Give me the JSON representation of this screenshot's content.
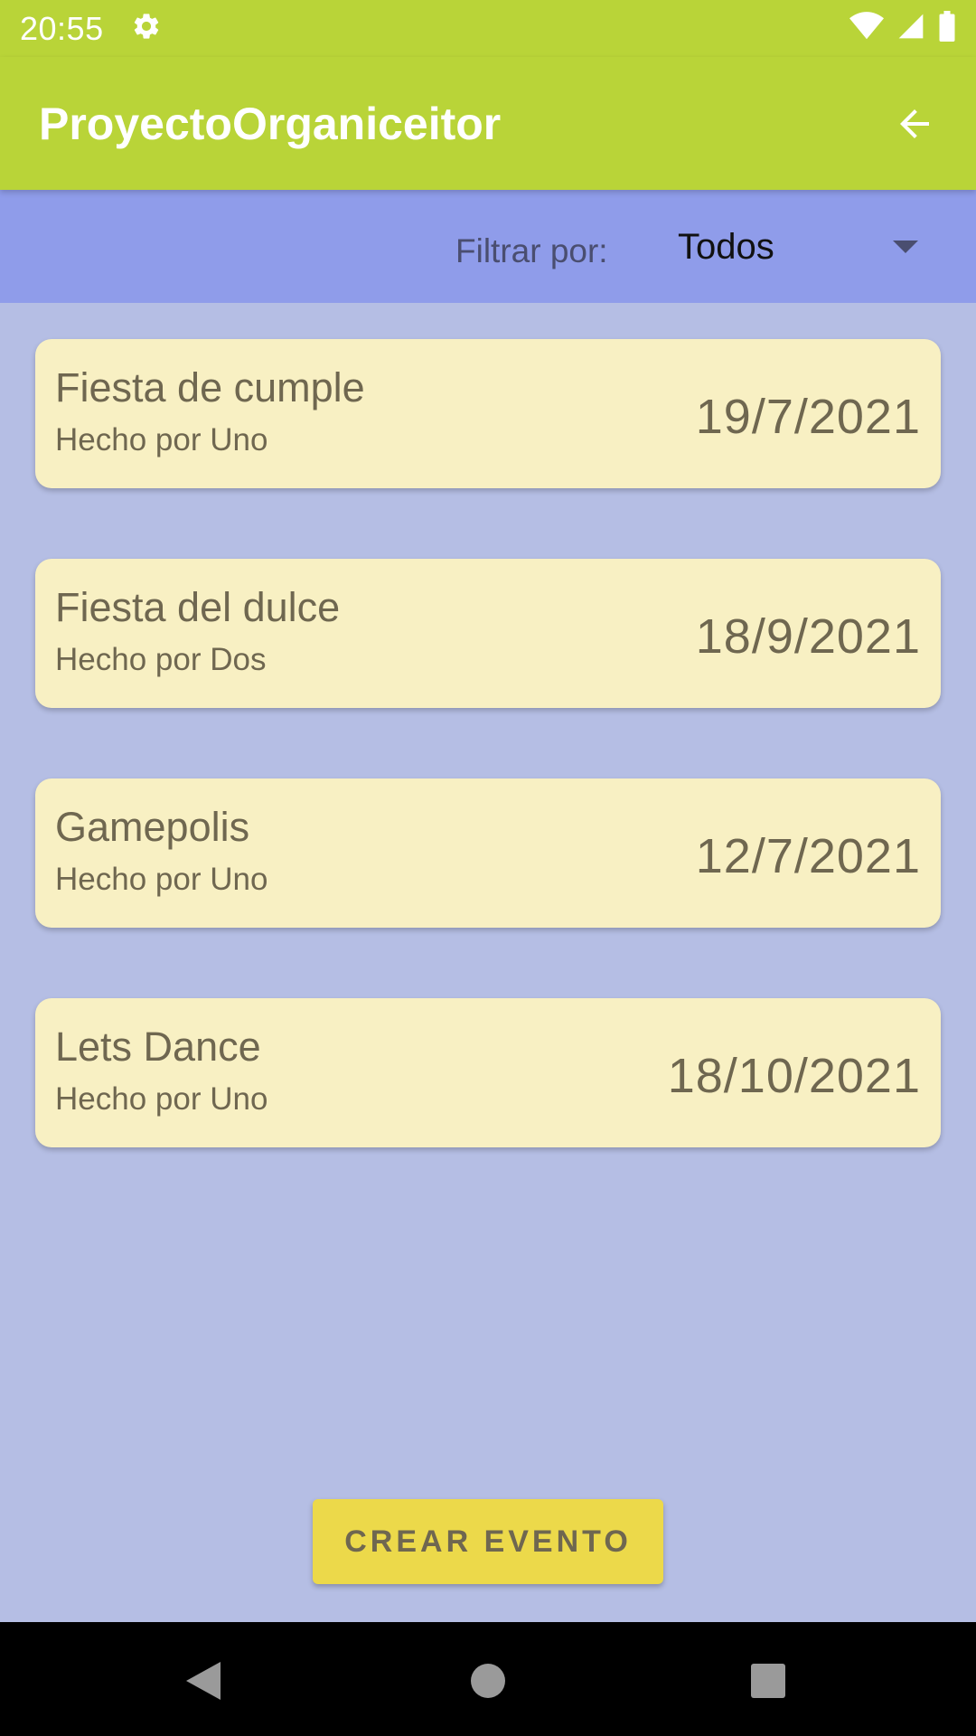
{
  "status_bar": {
    "time": "20:55",
    "icons": [
      "settings-icon",
      "wifi-icon",
      "signal-icon",
      "battery-icon"
    ]
  },
  "app_bar": {
    "title": "ProyectoOrganiceitor",
    "back_icon": "arrow-back-icon"
  },
  "filter": {
    "label": "Filtrar por:",
    "selected": "Todos"
  },
  "events": [
    {
      "name": "Fiesta de cumple",
      "author": "Hecho por Uno",
      "date": "19/7/2021"
    },
    {
      "name": "Fiesta del dulce",
      "author": "Hecho por Dos",
      "date": "18/9/2021"
    },
    {
      "name": "Gamepolis",
      "author": "Hecho por Uno",
      "date": "12/7/2021"
    },
    {
      "name": "Lets Dance",
      "author": "Hecho por Uno",
      "date": "18/10/2021"
    }
  ],
  "create_button": {
    "label": "CREAR EVENTO"
  },
  "nav_bar": {
    "icons": [
      "back-triangle-icon",
      "home-circle-icon",
      "recents-square-icon"
    ]
  },
  "colors": {
    "app_bar": "#b9d438",
    "filter_bar": "#8f9cea",
    "background": "#b5bee4",
    "card": "#f8f0c3",
    "button": "#ecd94a",
    "text": "#6f6750"
  }
}
